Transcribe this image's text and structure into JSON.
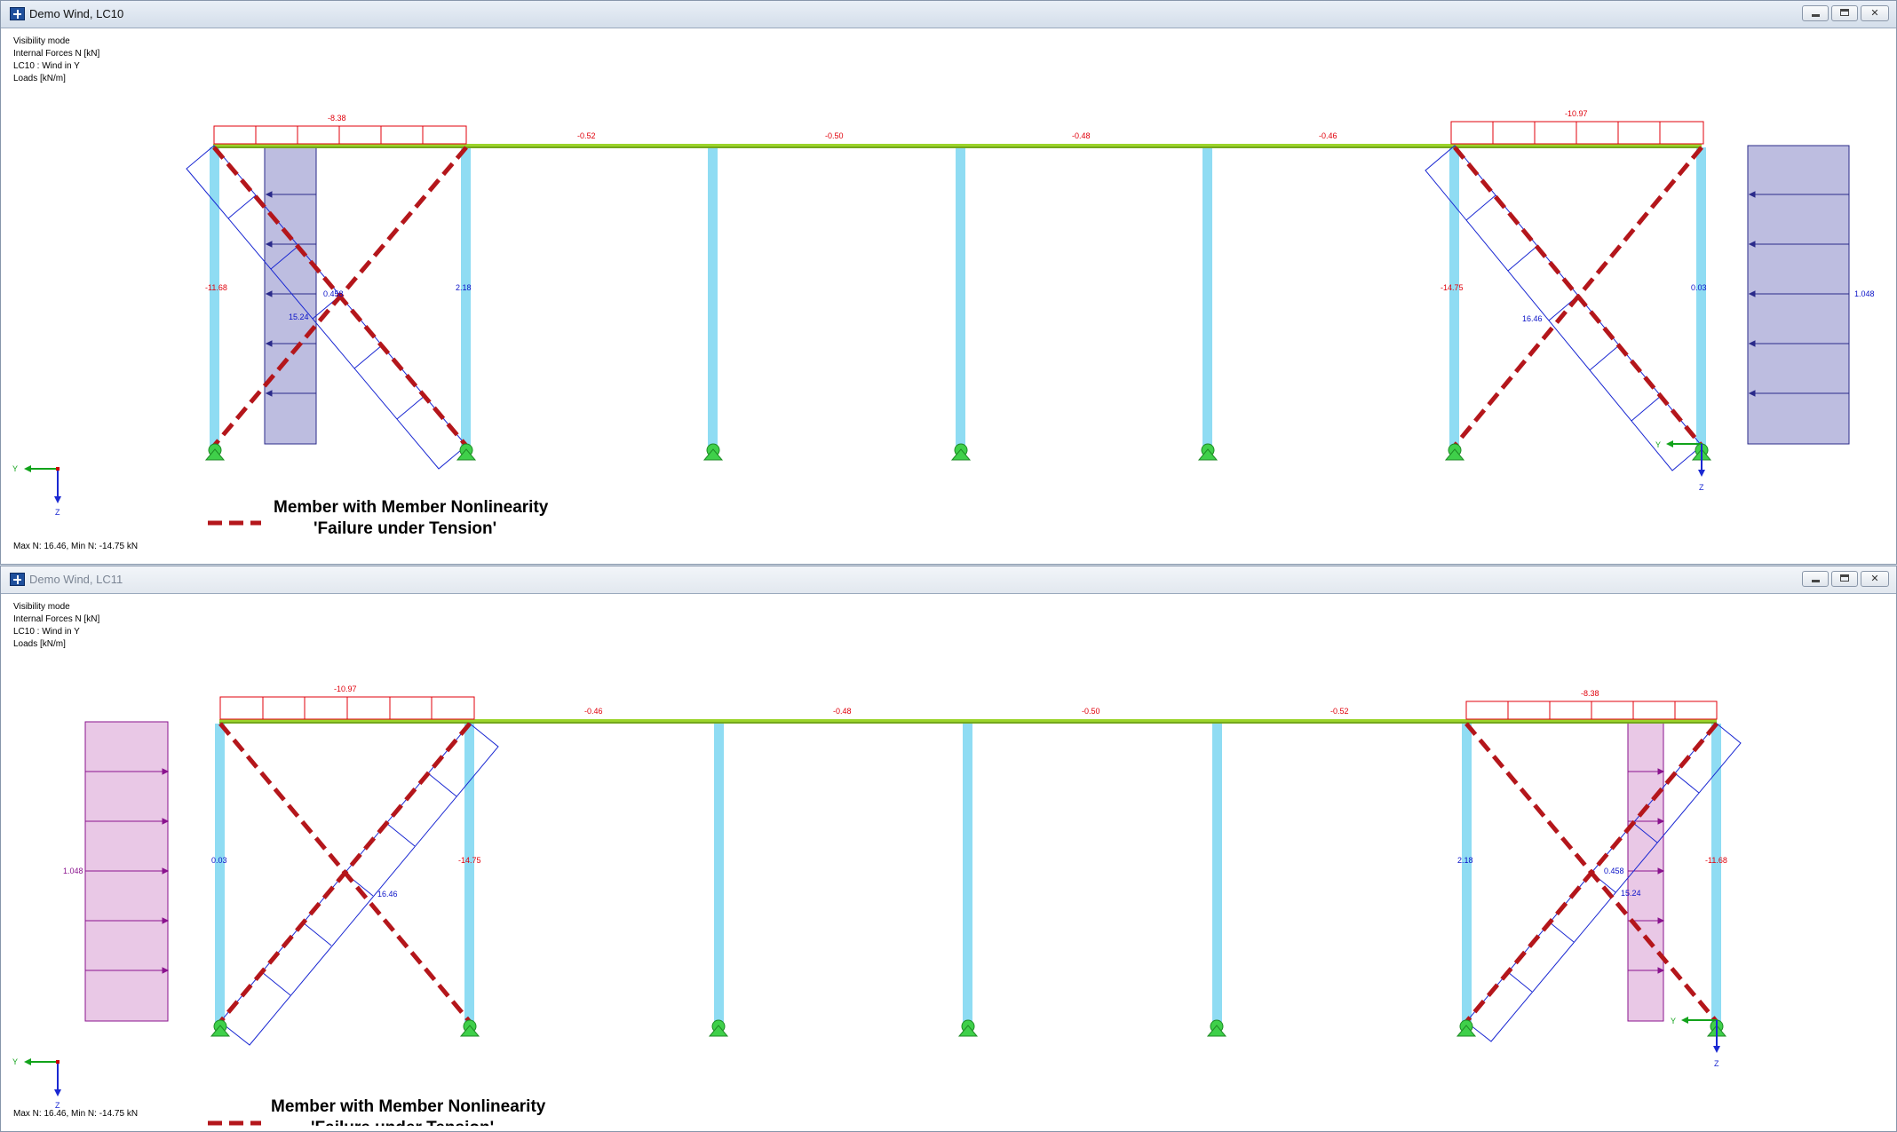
{
  "windows": [
    {
      "title": "Demo Wind, LC10",
      "active": true,
      "info": [
        "Visibility mode",
        "Internal Forces N [kN]",
        "LC10 : Wind in Y",
        "Loads [kN/m]"
      ],
      "summary": "Max N: 16.46, Min N: -14.75 kN",
      "top_chord_labels": [
        "-0.52",
        "-0.50",
        "-0.48",
        "-0.46"
      ],
      "left_bay_top_label": "-8.38",
      "right_bay_top_label": "-10.97",
      "left_column_label": "-11.68",
      "second_column_label": "2.18",
      "left_diagonal_label": "15.24",
      "left_intersection_label": "0.458",
      "right_third_column_label": "-14.75",
      "right_column_label": "0.03",
      "right_diagonal_label": "16.46",
      "wind_load_label": "1.048",
      "legend": {
        "line1": "Member with Member Nonlinearity",
        "line2": "'Failure under Tension'"
      },
      "axes": {
        "y": "Y",
        "z": "Z"
      }
    },
    {
      "title": "Demo Wind, LC11",
      "active": false,
      "info": [
        "Visibility mode",
        "Internal Forces N [kN]",
        "LC10 : Wind in Y",
        "Loads [kN/m]"
      ],
      "summary": "Max N: 16.46, Min N: -14.75 kN",
      "top_chord_labels": [
        "-0.46",
        "-0.48",
        "-0.50",
        "-0.52"
      ],
      "left_bay_top_label": "-10.97",
      "right_bay_top_label": "-8.38",
      "left_column_label": "0.03",
      "second_column_label": "-14.75",
      "left_diagonal_label": "16.46",
      "right_third_column_label": "2.18",
      "right_column_label": "-11.68",
      "right_diagonal_label": "15.24",
      "right_intersection_label": "0.458",
      "wind_load_label": "1.048",
      "legend": {
        "line1": "Member with Member Nonlinearity",
        "line2": "'Failure under Tension'"
      },
      "axes": {
        "y": "Y",
        "z": "Z"
      }
    }
  ],
  "colors": {
    "column": "#8fdcf3",
    "beam": "#9bd42a",
    "support": "#3fd04a",
    "failure_member": "#b4161b",
    "tension_diagram": "#1a28d2",
    "compression_diagram": "#e0000b",
    "wind_load_lc10": "#bdbde0",
    "wind_load_lc11": "#e9c8e6"
  },
  "icons": [
    "app-icon",
    "minimize-icon",
    "restore-icon",
    "close-icon"
  ]
}
